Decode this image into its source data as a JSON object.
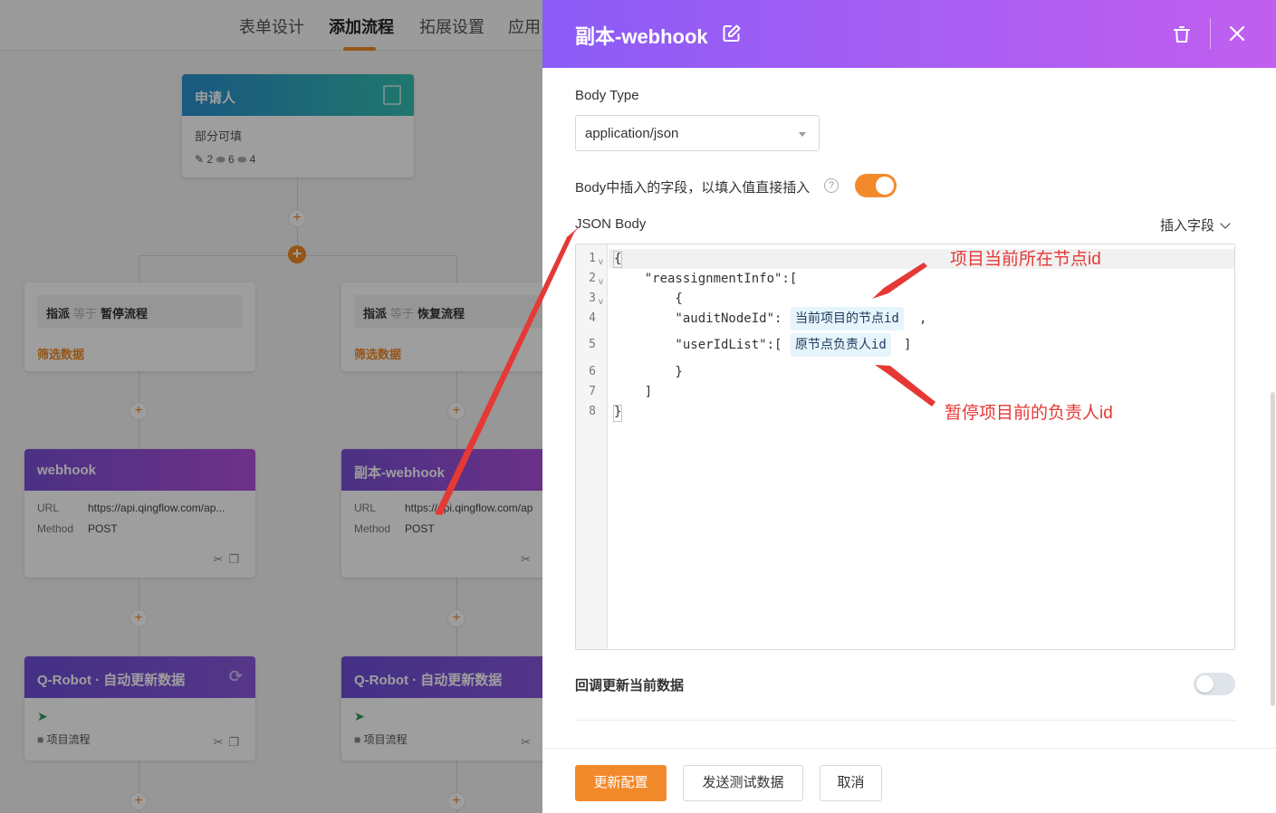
{
  "background": {
    "nav_tabs": [
      "表单设计",
      "添加流程",
      "拓展设置",
      "应用"
    ],
    "applicant_node": {
      "title": "申请人",
      "subtitle": "部分可填",
      "counts": [
        "2",
        "6",
        "4"
      ]
    },
    "filter_nodes": [
      {
        "field": "指派",
        "op": "等于",
        "value": "暂停流程",
        "label": "筛选数据"
      },
      {
        "field": "指派",
        "op": "等于",
        "value": "恢复流程",
        "label": "筛选数据"
      }
    ],
    "webhook_nodes": [
      {
        "title": "webhook",
        "url_key": "URL",
        "url": "https://api.qingflow.com/ap...",
        "method_key": "Method",
        "method": "POST"
      },
      {
        "title": "副本-webhook",
        "url_key": "URL",
        "url": "https://api.qingflow.com/ap",
        "method_key": "Method",
        "method": "POST"
      }
    ],
    "qrobot_nodes": [
      {
        "title": "Q-Robot · 自动更新数据",
        "item": "项目流程"
      },
      {
        "title": "Q-Robot · 自动更新数据",
        "item": "项目流程"
      }
    ]
  },
  "drawer": {
    "title": "副本-webhook",
    "body_type_label": "Body Type",
    "body_type_value": "application/json",
    "insert_direct_label": "Body中插入的字段，以填入值直接插入",
    "insert_direct_enabled": true,
    "json_body_label": "JSON Body",
    "insert_field_label": "插入字段",
    "editor": {
      "line_numbers": [
        "1",
        "2",
        "3",
        "4",
        "5",
        "6",
        "7",
        "8"
      ],
      "lines": [
        "{",
        "    \"reassignmentInfo\":[",
        "        {",
        "        \"auditNodeId\":",
        "        \"userIdList\":[",
        "        }",
        "    ]",
        "}"
      ],
      "tag_audit_node": "当前项目的节点id",
      "tag_user_list": "原节点负责人id",
      "comma": ",",
      "close_bracket": "]"
    },
    "callback_label": "回调更新当前数据",
    "callback_enabled": false,
    "buttons": {
      "update": "更新配置",
      "send_test": "发送测试数据",
      "cancel": "取消"
    }
  },
  "annotations": {
    "node_id": "项目当前所在节点id",
    "owner_id": "暂停项目前的负责人id"
  },
  "colors": {
    "accent": "#f28a2c",
    "header_start": "#8b5cf6",
    "header_end": "#c15fef",
    "annotation": "#e53935"
  }
}
